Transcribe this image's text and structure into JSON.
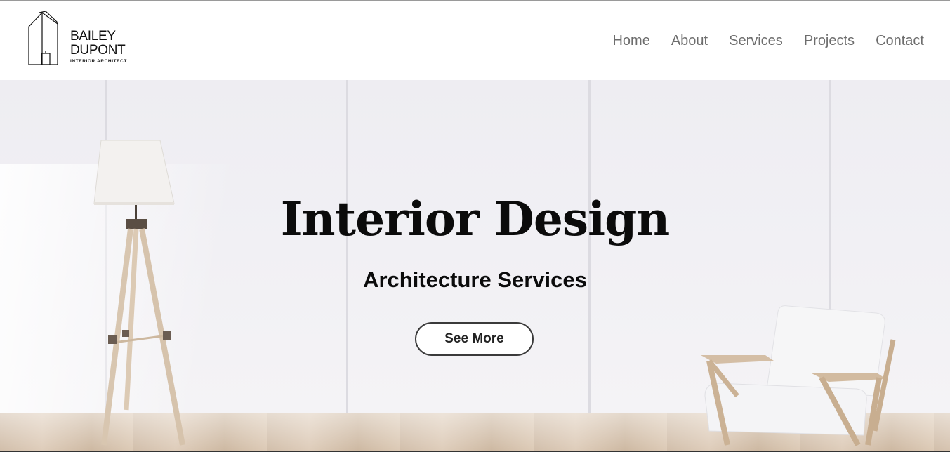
{
  "brand": {
    "line1": "BAILEY",
    "line2": "DUPONT",
    "tagline": "INTERIOR ARCHITECT"
  },
  "nav": {
    "items": [
      {
        "label": "Home"
      },
      {
        "label": "About"
      },
      {
        "label": "Services"
      },
      {
        "label": "Projects"
      },
      {
        "label": "Contact"
      }
    ]
  },
  "hero": {
    "title": "Interior Design",
    "subtitle": "Architecture Services",
    "cta_label": "See More"
  },
  "colors": {
    "nav_text": "#6d6d6d",
    "title_text": "#0b0b0b",
    "button_border": "#3a3a3a",
    "wall": "#eeedf2",
    "floor": "#c9b29a"
  }
}
